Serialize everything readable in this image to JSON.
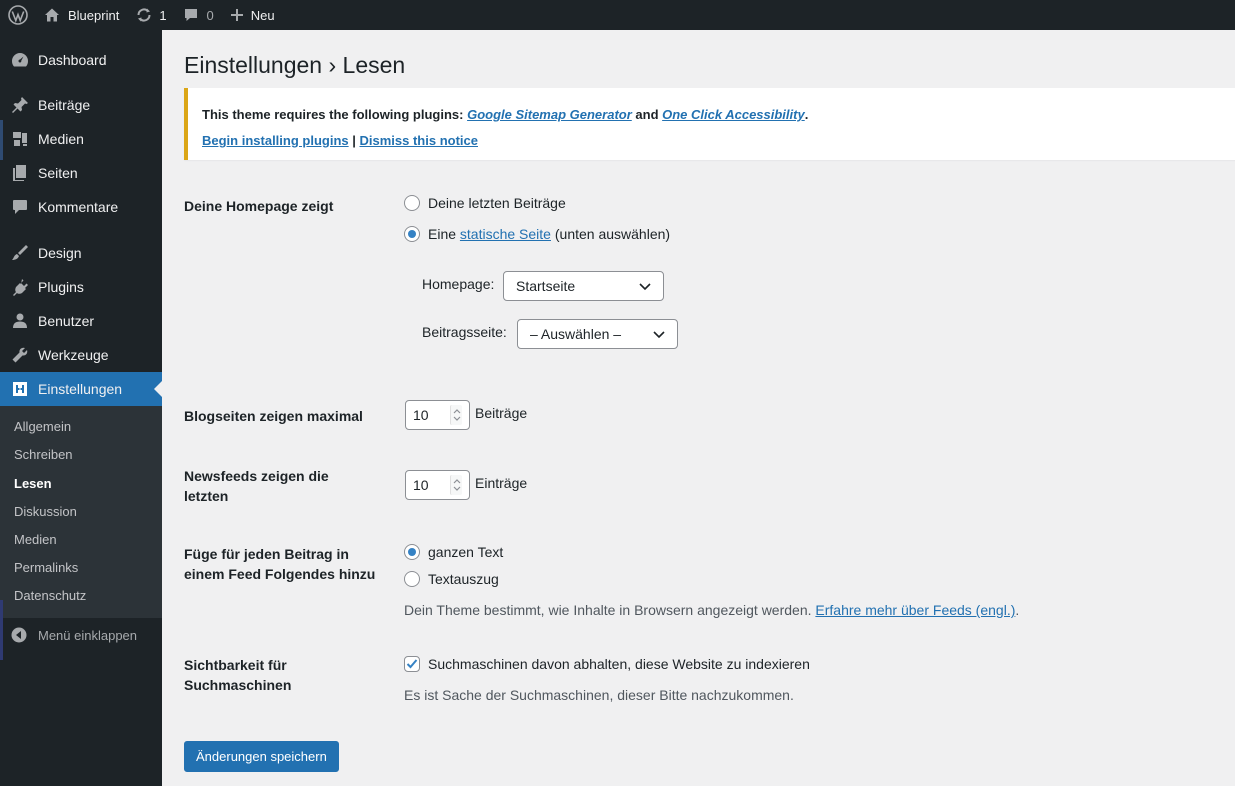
{
  "adminbar": {
    "site_name": "Blueprint",
    "updates_count": "1",
    "comments_count": "0",
    "new_label": "Neu"
  },
  "sidebar": {
    "items": [
      {
        "label": "Dashboard",
        "icon": "dashboard-icon"
      },
      {
        "label": "Beiträge",
        "icon": "pin-icon"
      },
      {
        "label": "Medien",
        "icon": "media-icon"
      },
      {
        "label": "Seiten",
        "icon": "pages-icon"
      },
      {
        "label": "Kommentare",
        "icon": "comment-icon"
      },
      {
        "label": "Design",
        "icon": "brush-icon"
      },
      {
        "label": "Plugins",
        "icon": "plugin-icon"
      },
      {
        "label": "Benutzer",
        "icon": "user-icon"
      },
      {
        "label": "Werkzeuge",
        "icon": "wrench-icon"
      },
      {
        "label": "Einstellungen",
        "icon": "settings-icon"
      }
    ],
    "submenu": [
      "Allgemein",
      "Schreiben",
      "Lesen",
      "Diskussion",
      "Medien",
      "Permalinks",
      "Datenschutz"
    ],
    "collapse_label": "Menü einklappen"
  },
  "page": {
    "title": "Einstellungen › Lesen"
  },
  "notice": {
    "text_before": "This theme requires the following plugins: ",
    "plugin1": "Google Sitemap Generator",
    "and": " and ",
    "plugin2": "One Click Accessibility",
    "period": ".",
    "begin_link": "Begin installing plugins",
    "separator": " | ",
    "dismiss_link": "Dismiss this notice"
  },
  "homepage": {
    "label": "Deine Homepage zeigt",
    "option_latest": "Deine letzten Beiträge",
    "option_static_prefix": "Eine ",
    "option_static_link": "statische Seite",
    "option_static_suffix": " (unten auswählen)",
    "selected": "static",
    "homepage_label": "Homepage:",
    "homepage_value": "Startseite",
    "postspage_label": "Beitragsseite:",
    "postspage_value": "– Auswählen –"
  },
  "blog_pages": {
    "label": "Blogseiten zeigen maximal",
    "value": "10",
    "unit": "Beiträge"
  },
  "feeds": {
    "label_line1": "Newsfeeds zeigen die",
    "label_line2": "letzten",
    "value": "10",
    "unit": "Einträge"
  },
  "feed_content": {
    "label_line1": "Füge für jeden Beitrag in",
    "label_line2": "einem Feed Folgendes hinzu",
    "option_full": "ganzen Text",
    "option_excerpt": "Textauszug",
    "selected": "full",
    "desc_text": "Dein Theme bestimmt, wie Inhalte in Browsern angezeigt werden. ",
    "desc_link": "Erfahre mehr über Feeds (engl.)",
    "desc_end": "."
  },
  "visibility": {
    "label_line1": "Sichtbarkeit für",
    "label_line2": "Suchmaschinen",
    "checkbox_label": "Suchmaschinen davon abhalten, diese Website zu indexieren",
    "checked": true,
    "desc": "Es ist Sache der Suchmaschinen, dieser Bitte nachzukommen."
  },
  "submit_label": "Änderungen speichern",
  "colors": {
    "accent": "#2271b1",
    "notice_warning": "#dba617",
    "sidebar_bg": "#1d2327"
  }
}
